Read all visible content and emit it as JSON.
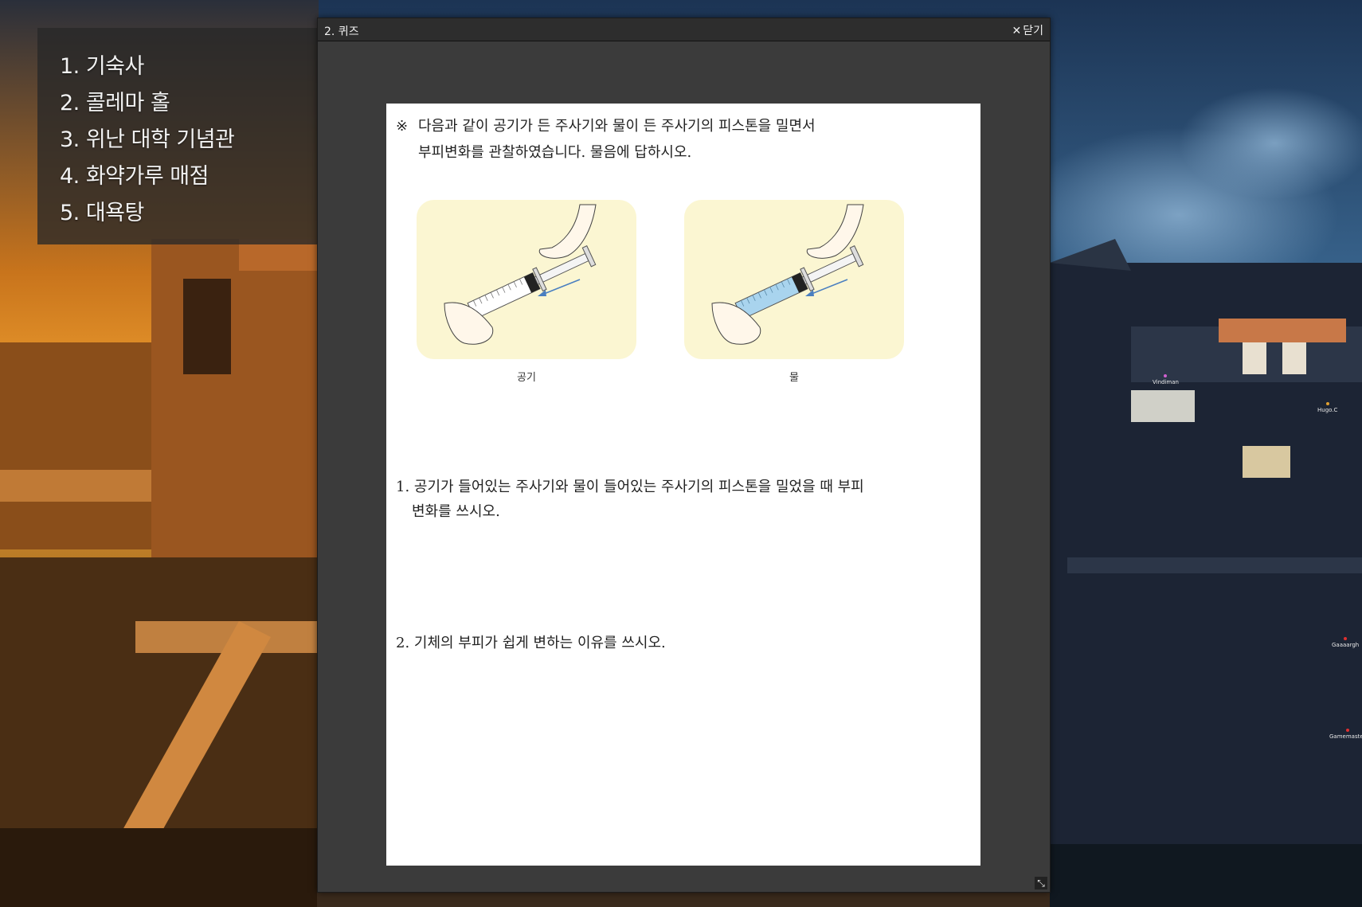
{
  "location_menu": {
    "items": [
      "1. 기숙사",
      "2. 콜레마 홀",
      "3. 위난 대학 기념관",
      "4. 화약가루 매점",
      "5. 대욕탕"
    ]
  },
  "quiz_window": {
    "title": "2. 퀴즈",
    "close_label": "닫기",
    "worksheet": {
      "instruction_mark": "※",
      "instruction_line1": "다음과 같이 공기가 든 주사기와 물이 든 주사기의 피스톤을 밀면서",
      "instruction_line2": "부피변화를 관찰하였습니다. 물음에 답하시오.",
      "figure_captions": [
        "공기",
        "물"
      ],
      "question1_line1": "1. 공기가 들어있는 주사기와 물이 들어있는 주사기의 피스톤을 밀었을 때 부피",
      "question1_line2": "변화를 쓰시오.",
      "question2": "2. 기체의 부피가 쉽게 변하는 이유를 쓰시오."
    }
  },
  "player_nametags": [
    "Vindiman",
    "Hugo.C",
    "Gaaaargh",
    "Gamemaster"
  ],
  "colors": {
    "menu_bg": "#282828",
    "window_bg": "#3a3a3a",
    "sheet_bg": "#ffffff",
    "panel_bg": "#fbf6d2",
    "arrow": "#4a7fc0",
    "water": "#a9d4ee"
  }
}
